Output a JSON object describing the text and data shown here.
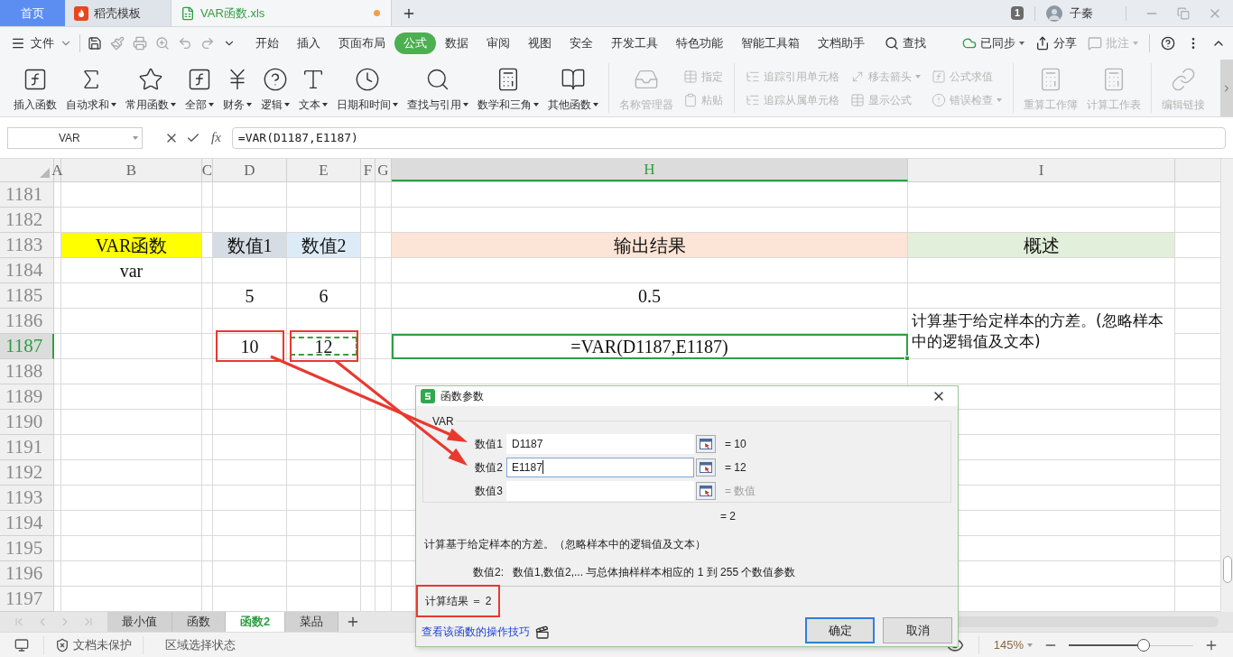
{
  "tabs": [
    {
      "label": "首页",
      "kind": "home",
      "selected": false
    },
    {
      "label": "稻壳模板",
      "kind": "docer",
      "selected": false
    },
    {
      "label": "VAR函数.xls",
      "kind": "sheet",
      "selected": true,
      "unsaved": true
    }
  ],
  "window": {
    "badge": "1",
    "user": "子秦"
  },
  "menu": {
    "file": "文件",
    "tabs": [
      {
        "label": "开始",
        "selected": false
      },
      {
        "label": "插入",
        "selected": false
      },
      {
        "label": "页面布局",
        "selected": false
      },
      {
        "label": "公式",
        "selected": true
      },
      {
        "label": "数据",
        "selected": false
      },
      {
        "label": "审阅",
        "selected": false
      },
      {
        "label": "视图",
        "selected": false
      },
      {
        "label": "安全",
        "selected": false
      },
      {
        "label": "开发工具",
        "selected": false
      },
      {
        "label": "特色功能",
        "selected": false
      },
      {
        "label": "智能工具箱",
        "selected": false
      },
      {
        "label": "文档助手",
        "selected": false
      }
    ],
    "search": "查找",
    "sync": "已同步",
    "share": "分享",
    "comment": {
      "label": "批注",
      "disabled": true
    }
  },
  "ribbon": {
    "groups": [
      {
        "items": [
          {
            "kind": "large",
            "label": "插入函数",
            "dropdown": false,
            "disabled": false
          },
          {
            "kind": "large",
            "label": "自动求和",
            "dropdown": true,
            "disabled": false
          },
          {
            "kind": "large",
            "label": "常用函数",
            "dropdown": true,
            "disabled": false
          },
          {
            "kind": "large",
            "label": "全部",
            "dropdown": true,
            "disabled": false
          },
          {
            "kind": "large",
            "label": "财务",
            "dropdown": true,
            "disabled": false
          },
          {
            "kind": "large",
            "label": "逻辑",
            "dropdown": true,
            "disabled": false
          },
          {
            "kind": "large",
            "label": "文本",
            "dropdown": true,
            "disabled": false
          },
          {
            "kind": "large",
            "label": "日期和时间",
            "dropdown": true,
            "disabled": false
          },
          {
            "kind": "large",
            "label": "查找与引用",
            "dropdown": true,
            "disabled": false
          },
          {
            "kind": "large",
            "label": "数学和三角",
            "dropdown": true,
            "disabled": false
          },
          {
            "kind": "large",
            "label": "其他函数",
            "dropdown": true,
            "disabled": false
          }
        ]
      },
      {
        "items": [
          {
            "kind": "large",
            "label": "名称管理器",
            "dropdown": false,
            "disabled": true
          },
          {
            "kind": "small",
            "label": "指定",
            "dropdown": false,
            "disabled": true
          },
          {
            "kind": "small",
            "label": "粘贴",
            "dropdown": false,
            "disabled": true
          }
        ]
      },
      {
        "items": [
          {
            "kind": "small",
            "label": "追踪引用单元格",
            "dropdown": false,
            "disabled": true
          },
          {
            "kind": "small",
            "label": "追踪从属单元格",
            "dropdown": false,
            "disabled": true
          },
          {
            "kind": "small",
            "label": "移去箭头",
            "dropdown": true,
            "disabled": true
          },
          {
            "kind": "small",
            "label": "显示公式",
            "dropdown": false,
            "disabled": true
          },
          {
            "kind": "small",
            "label": "公式求值",
            "dropdown": false,
            "disabled": true
          },
          {
            "kind": "small",
            "label": "错误检查",
            "dropdown": true,
            "disabled": true
          }
        ]
      },
      {
        "items": [
          {
            "kind": "large",
            "label": "重算工作簿",
            "dropdown": false,
            "disabled": true
          },
          {
            "kind": "large",
            "label": "计算工作表",
            "dropdown": false,
            "disabled": true
          }
        ]
      },
      {
        "items": [
          {
            "kind": "large",
            "label": "编辑链接",
            "dropdown": false,
            "disabled": true
          }
        ]
      }
    ]
  },
  "formula_bar": {
    "name_box": "VAR",
    "insert_function": "fx",
    "formula": "=VAR(D1187,E1187)"
  },
  "sheet": {
    "columns": [
      {
        "label": "A",
        "selected": false
      },
      {
        "label": "B",
        "selected": false
      },
      {
        "label": "C",
        "selected": false
      },
      {
        "label": "D",
        "selected": false
      },
      {
        "label": "E",
        "selected": false
      },
      {
        "label": "F",
        "selected": false
      },
      {
        "label": "G",
        "selected": false
      },
      {
        "label": "H",
        "selected": true
      },
      {
        "label": "I",
        "selected": false
      }
    ],
    "rows": [
      {
        "number": "1181",
        "selected": false
      },
      {
        "number": "1182",
        "selected": false
      },
      {
        "number": "1183",
        "selected": false,
        "cells": {
          "B": {
            "text": "VAR函数",
            "color": "#ffff00"
          },
          "D": {
            "text": "数值1",
            "color": "#d6dce4"
          },
          "E": {
            "text": "数值2",
            "color": "#ddebf7"
          },
          "H": {
            "text": "输出结果",
            "color": "#fce4d6"
          },
          "I": {
            "text": "概述",
            "color": "#e2efda"
          }
        }
      },
      {
        "number": "1184",
        "selected": false,
        "cells": {
          "B": {
            "text": "var"
          }
        }
      },
      {
        "number": "1185",
        "selected": false,
        "cells": {
          "D": {
            "text": "5"
          },
          "E": {
            "text": "6"
          },
          "H": {
            "text": "0.5"
          }
        }
      },
      {
        "number": "1186",
        "selected": false,
        "cells": {
          "I": {
            "text": "计算基于给定样本的方差。(忽略样本中的逻辑值及文本)",
            "kind": "wrap"
          }
        }
      },
      {
        "number": "1187",
        "selected": true,
        "cells": {
          "D": {
            "text": "10",
            "boxed": true
          },
          "E": {
            "text": "12",
            "boxed": true,
            "marquee": true
          },
          "H": {
            "text": "=VAR(D1187,E1187)",
            "active": true
          }
        }
      },
      {
        "number": "1188",
        "selected": false
      },
      {
        "number": "1189",
        "selected": false
      },
      {
        "number": "1190",
        "selected": false
      },
      {
        "number": "1191",
        "selected": false
      },
      {
        "number": "1192",
        "selected": false
      },
      {
        "number": "1193",
        "selected": false
      },
      {
        "number": "1194",
        "selected": false
      },
      {
        "number": "1195",
        "selected": false
      },
      {
        "number": "1196",
        "selected": false
      },
      {
        "number": "1197",
        "selected": false
      }
    ]
  },
  "sheet_tabs": [
    {
      "label": "最小值",
      "selected": false
    },
    {
      "label": "函数",
      "selected": false
    },
    {
      "label": "函数2",
      "selected": true
    },
    {
      "label": "菜品",
      "selected": false
    }
  ],
  "status_bar": {
    "protection": "文档未保护",
    "mode": "区域选择状态",
    "zoom": "145%",
    "zoom_slider": {
      "level": 0.6
    }
  },
  "dialog": {
    "title": "函数参数",
    "function": "VAR",
    "args": [
      {
        "label": "数值1",
        "value": "D1187",
        "result": "= 10",
        "focused": false,
        "muted": false
      },
      {
        "label": "数值2",
        "value": "E1187",
        "result": "= 12",
        "focused": true,
        "muted": false
      },
      {
        "label": "数值3",
        "result": "= 数值",
        "focused": false,
        "muted": true
      }
    ],
    "result": "= 2",
    "description": "计算基于给定样本的方差。（忽略样本中的逻辑值及文本）",
    "arg_name": "数值2:",
    "arg_help": "数值1,数值2,... 与总体抽样样本相应的 1 到 255 个数值参数",
    "computed": {
      "text": "计算结果 ＝ 2",
      "boxed": true
    },
    "link": "查看该函数的操作技巧",
    "buttons": [
      {
        "label": "确定",
        "default": true
      },
      {
        "label": "取消",
        "default": false
      }
    ]
  }
}
